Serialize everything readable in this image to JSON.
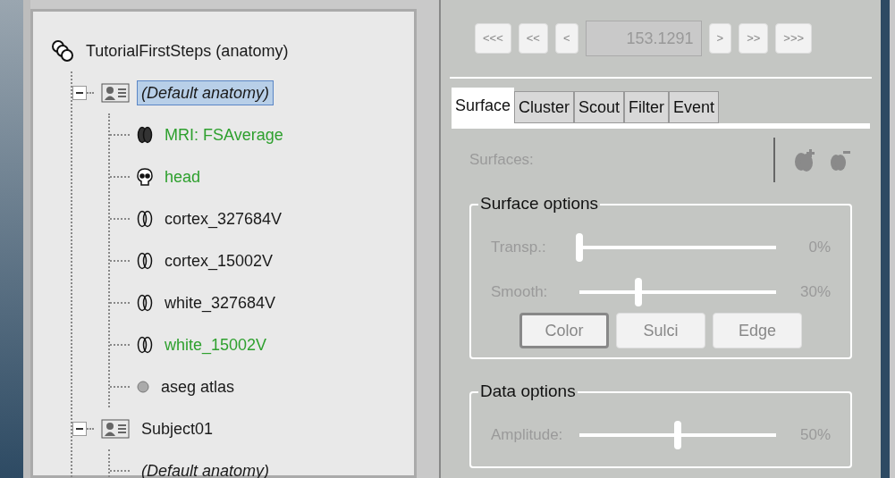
{
  "tree": {
    "label": "TutorialFirstSteps (anatomy)",
    "kind": "study",
    "children": [
      {
        "label": "(Default anatomy)",
        "kind": "subject",
        "italic": true,
        "selected": true,
        "expanded": true,
        "children": [
          {
            "label": "MRI: FSAverage",
            "kind": "mri",
            "color": "#2ea02e",
            "selected": false
          },
          {
            "label": "head",
            "kind": "head",
            "color": "#2ea02e",
            "selected": false
          },
          {
            "label": "cortex_327684V",
            "kind": "surface",
            "color": "#1a1a1a",
            "selected": false
          },
          {
            "label": "cortex_15002V",
            "kind": "surface",
            "color": "#1a1a1a",
            "selected": false
          },
          {
            "label": "white_327684V",
            "kind": "surface",
            "color": "#1a1a1a",
            "selected": false
          },
          {
            "label": "white_15002V",
            "kind": "surface",
            "color": "#2ea02e",
            "selected": false
          },
          {
            "label": "aseg atlas",
            "kind": "atlas",
            "color": "#1a1a1a",
            "selected": false
          }
        ]
      },
      {
        "label": "Subject01",
        "kind": "subject",
        "italic": false,
        "selected": false,
        "expanded": true,
        "children": [
          {
            "label": "(Default anatomy)",
            "kind": "none",
            "italic": true,
            "color": "#1a1a1a",
            "selected": false
          }
        ]
      }
    ]
  },
  "navigation": {
    "buttons_left": [
      "<<<",
      "<<",
      "<"
    ],
    "value": "153.1291",
    "buttons_right": [
      ">",
      ">>",
      ">>>"
    ]
  },
  "tabs": [
    {
      "label": "Surface",
      "selected": true
    },
    {
      "label": "Cluster",
      "selected": false
    },
    {
      "label": "Scout",
      "selected": false
    },
    {
      "label": "Filter",
      "selected": false
    },
    {
      "label": "Event",
      "selected": false
    }
  ],
  "surfaces_label": "Surfaces:",
  "surface_options": {
    "title": "Surface options",
    "sliders": [
      {
        "label": "Transp.:",
        "level": 0,
        "reading": "0%"
      },
      {
        "label": "Smooth:",
        "level": 0.3,
        "reading": "30%"
      }
    ],
    "buttons": [
      {
        "label": "Color",
        "selected": true
      },
      {
        "label": "Sulci",
        "selected": false
      },
      {
        "label": "Edge",
        "selected": false
      }
    ]
  },
  "data_options": {
    "title": "Data options",
    "sliders": [
      {
        "label": "Amplitude:",
        "level": 0.5,
        "reading": "50%"
      }
    ]
  }
}
